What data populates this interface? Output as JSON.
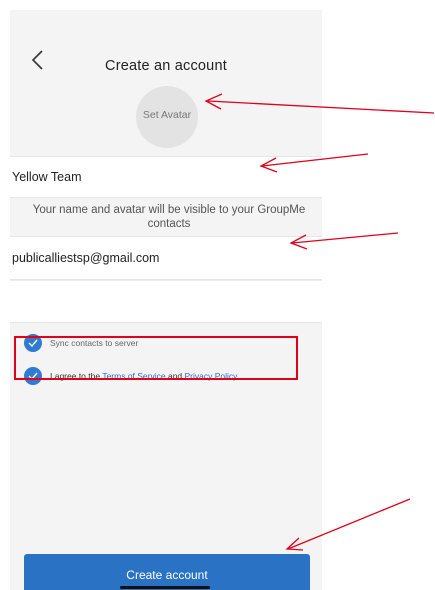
{
  "header": {
    "title": "Create an account"
  },
  "avatar": {
    "label": "Set Avatar"
  },
  "form": {
    "name_value": "Yellow Team",
    "hint": "Your name and avatar will be visible to your GroupMe contacts",
    "email_value": "publicalliestsp@gmail.com",
    "phone_value": ""
  },
  "options": {
    "sync_label": "Sync contacts to server",
    "agree_prefix": "I agree to the ",
    "terms_link": "Terms of Service",
    "agree_middle": " and ",
    "privacy_link": "Privacy Policy"
  },
  "actions": {
    "create_label": "Create account"
  },
  "colors": {
    "accent": "#2a72c4",
    "annotation": "#e0001b",
    "background": "#f4f4f4"
  },
  "icons": {
    "back": "chevron-left-icon",
    "check": "checkmark-icon"
  }
}
